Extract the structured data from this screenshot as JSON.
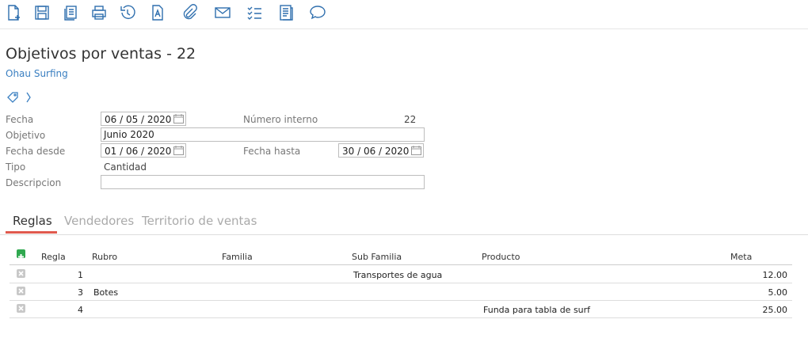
{
  "toolbar": {
    "icons": [
      "new-document-icon",
      "save-icon",
      "copy-icon",
      "print-icon",
      "history-icon",
      "text-document-icon",
      "attachment-icon",
      "email-icon",
      "checklist-icon",
      "report-icon",
      "comment-icon"
    ]
  },
  "header": {
    "title": "Objetivos por ventas - 22",
    "company": "Ohau Surfing"
  },
  "form": {
    "fecha_label": "Fecha",
    "fecha_value": "06 / 05 / 2020",
    "numero_label": "Número interno",
    "numero_value": "22",
    "objetivo_label": "Objetivo",
    "objetivo_value": "Junio 2020",
    "fecha_desde_label": "Fecha desde",
    "fecha_desde_value": "01 / 06 / 2020",
    "fecha_hasta_label": "Fecha hasta",
    "fecha_hasta_value": "30 / 06 / 2020",
    "tipo_label": "Tipo",
    "tipo_value": "Cantidad",
    "descripcion_label": "Descripcion",
    "descripcion_value": ""
  },
  "tabs": [
    "Reglas",
    "Vendedores",
    "Territorio de ventas"
  ],
  "grid": {
    "headers": {
      "regla": "Regla",
      "rubro": "Rubro",
      "familia": "Familia",
      "subfamilia": "Sub Familia",
      "producto": "Producto",
      "meta": "Meta"
    },
    "rows": [
      {
        "regla": "1",
        "rubro": "",
        "familia": "",
        "subfamilia": "Transportes de agua",
        "producto": "",
        "meta": "12.00"
      },
      {
        "regla": "3",
        "rubro": "Botes",
        "familia": "",
        "subfamilia": "",
        "producto": "",
        "meta": "5.00"
      },
      {
        "regla": "4",
        "rubro": "",
        "familia": "",
        "subfamilia": "",
        "producto": "Funda para tabla de surf",
        "meta": "25.00"
      }
    ]
  },
  "colors": {
    "icon": "#2f6fae",
    "link": "#3a7fc1",
    "tab_accent": "#e05a4e",
    "add": "#2fa84f"
  }
}
